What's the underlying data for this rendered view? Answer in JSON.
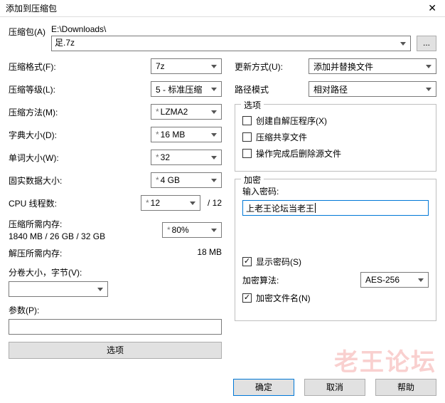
{
  "window": {
    "title": "添加到压缩包",
    "close": "✕"
  },
  "archive": {
    "label": "压缩包(A)",
    "path_prefix": "E:\\Downloads\\",
    "filename": "足.7z",
    "browse": "..."
  },
  "left": {
    "format_label": "压缩格式(F)",
    "format_value": "7z",
    "level_label": "压缩等级(L)",
    "level_value": "5 - 标准压缩",
    "method_label": "压缩方法(M)",
    "method_value": "LZMA2",
    "dict_label": "字典大小(D)",
    "dict_value": "16 MB",
    "word_label": "单词大小(W)",
    "word_value": "32",
    "solid_label": "固实数据大小",
    "solid_value": "4 GB",
    "threads_label": "CPU 线程数",
    "threads_value": "12",
    "threads_total": "/ 12",
    "mem_compress_label": "压缩所需内存",
    "mem_compress_value": "1840 MB / 26 GB / 32 GB",
    "mem_percent": "80%",
    "mem_decompress_label": "解压所需内存",
    "mem_decompress_value": "18 MB",
    "split_label": "分卷大小，字节(V)",
    "params_label": "参数(P)",
    "options_btn": "选项"
  },
  "right": {
    "update_label": "更新方式(U)",
    "update_value": "添加并替换文件",
    "pathmode_label": "路径模式",
    "pathmode_value": "相对路径",
    "options_group": "选项",
    "opt_sfx": "创建自解压程序(X)",
    "opt_share": "压缩共享文件",
    "opt_delete": "操作完成后删除源文件",
    "encrypt_group": "加密",
    "pw_label": "输入密码",
    "pw_value": "上老王论坛当老王",
    "show_pw": "显示密码(S)",
    "enc_method_label": "加密算法",
    "enc_method_value": "AES-256",
    "enc_filenames": "加密文件名(N)"
  },
  "buttons": {
    "ok": "确定",
    "cancel": "取消",
    "help": "帮助"
  },
  "watermark": {
    "main": "老王论坛",
    "sub": ""
  }
}
